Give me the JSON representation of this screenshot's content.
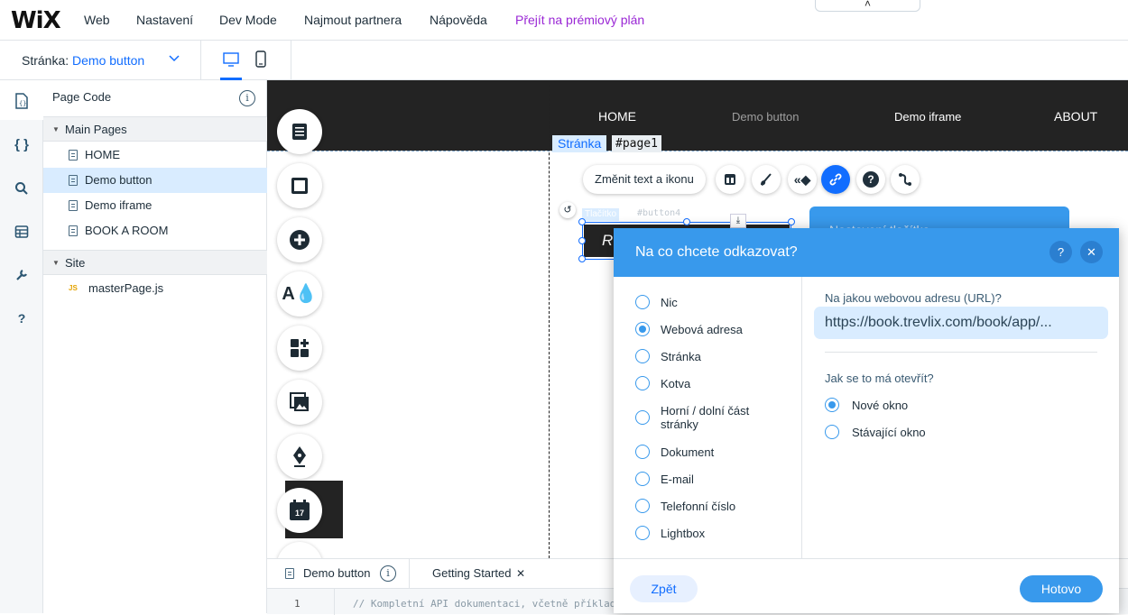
{
  "topbar": {
    "logo": "WiX",
    "menu": [
      "Web",
      "Nastavení",
      "Dev Mode",
      "Najmout partnera",
      "Nápověda",
      "Přejít na prémiový plán"
    ],
    "collapse": "˄"
  },
  "pagebar": {
    "label": "Stránka: ",
    "page_name": "Demo button"
  },
  "code_panel": {
    "title": "Page Code",
    "info": "i",
    "main_pages_label": "Main Pages",
    "pages": [
      "HOME",
      "Demo button",
      "Demo iframe",
      "BOOK A ROOM"
    ],
    "site_label": "Site",
    "site_files": [
      "masterPage.js"
    ],
    "js_badge": "JS"
  },
  "canvas": {
    "nav": [
      "HOME",
      "Demo button",
      "Demo iframe",
      "ABOUT"
    ],
    "page_tag": "Stránka",
    "page_id": "#page1",
    "change_text_button": "Změnit text a ikonu",
    "element_tag": "Tlačítko",
    "element_id": "#button4",
    "button_text": "R",
    "behind_panel_text": "Nastavení tlačítka",
    "calendar_day": "17"
  },
  "dialog": {
    "title": "Na co chcete odkazovat?",
    "help": "?",
    "close": "✕",
    "options": [
      "Nic",
      "Webová adresa",
      "Stránka",
      "Kotva",
      "Horní / dolní část stránky",
      "Dokument",
      "E-mail",
      "Telefonní číslo",
      "Lightbox"
    ],
    "selected_option": "Webová adresa",
    "url_label": "Na jakou webovou adresu (URL)?",
    "url_value": "https://book.trevlix.com/book/app/...",
    "open_label": "Jak se to má otevřít?",
    "open_options": [
      "Nové okno",
      "Stávající okno"
    ],
    "open_selected": "Nové okno",
    "back": "Zpět",
    "done": "Hotovo"
  },
  "code_editor": {
    "tabs": [
      "Demo button",
      "Getting Started"
    ],
    "tab_close": "✕",
    "line_number": "1",
    "line_text": "// Kompletní API dokumentaci, včetně příklad"
  }
}
